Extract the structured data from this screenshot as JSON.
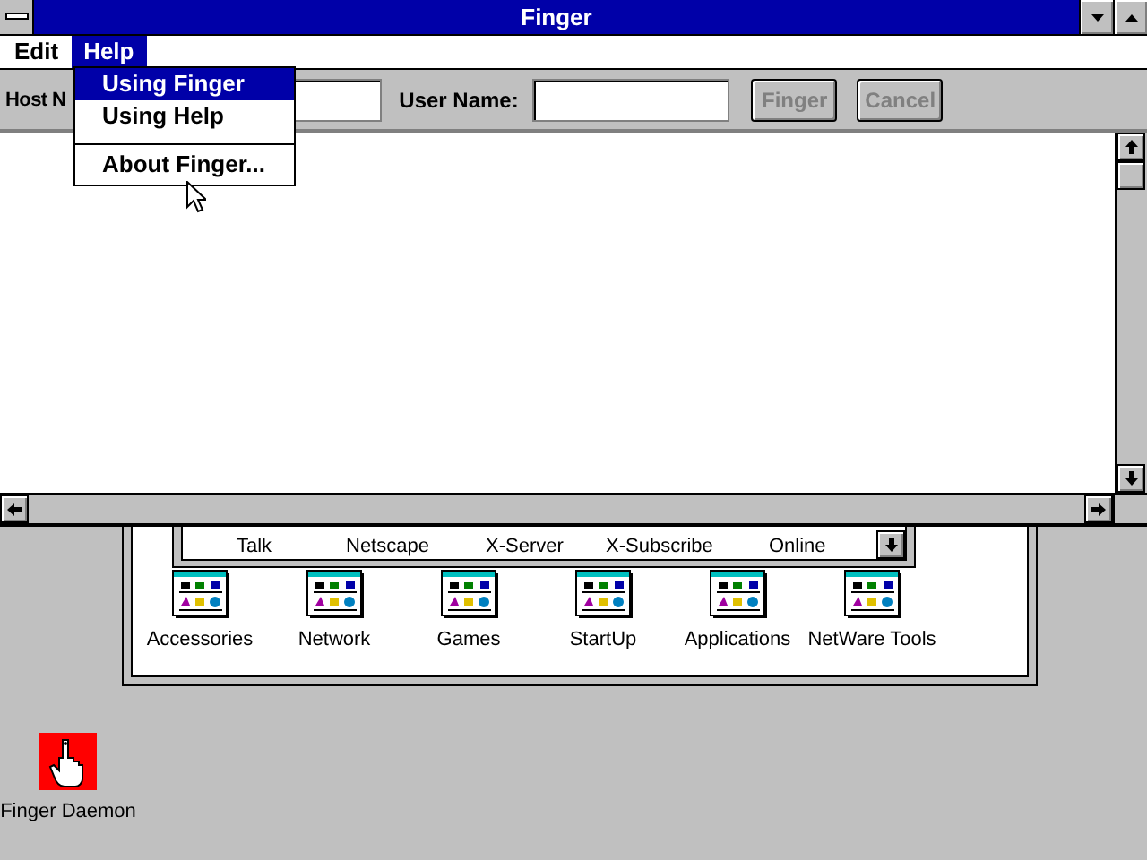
{
  "window": {
    "title": "Finger"
  },
  "menu_bar": [
    {
      "label": "Edit",
      "selected": false
    },
    {
      "label": "Help",
      "selected": true
    }
  ],
  "help_menu": [
    {
      "kind": "item",
      "label": "Using Finger",
      "selected": true
    },
    {
      "kind": "item",
      "label": "Using Help",
      "selected": false
    },
    {
      "kind": "separator"
    },
    {
      "kind": "item",
      "label": "About Finger...",
      "selected": false
    }
  ],
  "toolbar": {
    "host_label": "Host N",
    "user_label": "User Name:",
    "buttons": [
      {
        "label": "Finger",
        "disabled": true
      },
      {
        "label": "Cancel",
        "disabled": true
      }
    ]
  },
  "program_manager": {
    "hidden_group_row": [
      "Talk",
      "Netscape",
      "X-Server",
      "X-Subscribe",
      "Online"
    ],
    "groups": [
      "Accessories",
      "Network",
      "Games",
      "StartUp",
      "Applications",
      "NetWare Tools"
    ]
  },
  "desktop_icons": [
    {
      "label": "Finger Daemon"
    }
  ]
}
